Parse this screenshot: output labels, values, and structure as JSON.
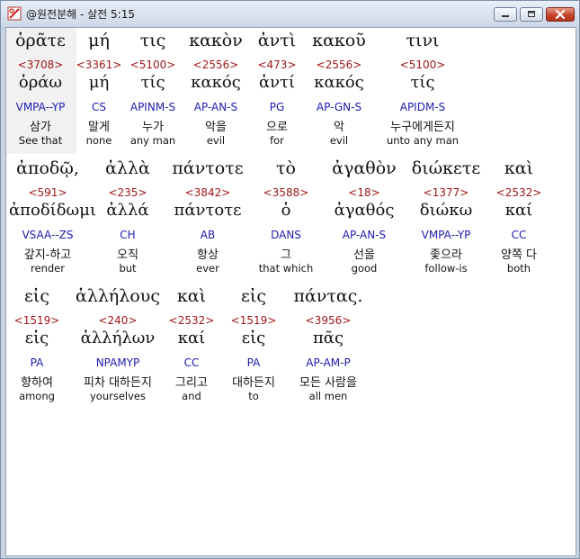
{
  "window": {
    "title": "@원전분해 - 살전 5:15"
  },
  "lines": [
    [
      {
        "greek": "ὁρᾶτε",
        "strongs": "<3708>",
        "lemma": "ὁράω",
        "parse": "VMPA--YP",
        "korean": "삼가",
        "english": "See that"
      },
      {
        "greek": "μή",
        "strongs": "<3361>",
        "lemma": "μή",
        "parse": "CS",
        "korean": "말게",
        "english": "none"
      },
      {
        "greek": "τις",
        "strongs": "<5100>",
        "lemma": "τίς",
        "parse": "APINM-S",
        "korean": "누가",
        "english": "any man"
      },
      {
        "greek": "κακὸν",
        "strongs": "<2556>",
        "lemma": "κακός",
        "parse": "AP-AN-S",
        "korean": "악을",
        "english": "evil"
      },
      {
        "greek": "ἀντὶ",
        "strongs": "<473>",
        "lemma": "ἀντί",
        "parse": "PG",
        "korean": "으로",
        "english": "for"
      },
      {
        "greek": "κακοῦ",
        "strongs": "<2556>",
        "lemma": "κακός",
        "parse": "AP-GN-S",
        "korean": "악",
        "english": "evil"
      },
      {
        "greek": "τινι",
        "strongs": "<5100>",
        "lemma": "τίς",
        "parse": "APIDM-S",
        "korean": "누구에게든지",
        "english": "unto any man"
      }
    ],
    [
      {
        "greek": "ἀποδῷ,",
        "strongs": "<591>",
        "lemma": "ἀποδίδωμι",
        "parse": "VSAA--ZS",
        "korean": "갚지-하고",
        "english": "render"
      },
      {
        "greek": "ἀλλὰ",
        "strongs": "<235>",
        "lemma": "ἀλλά",
        "parse": "CH",
        "korean": "오직",
        "english": "but"
      },
      {
        "greek": "πάντοτε",
        "strongs": "<3842>",
        "lemma": "πάντοτε",
        "parse": "AB",
        "korean": "항상",
        "english": "ever"
      },
      {
        "greek": "τὸ",
        "strongs": "<3588>",
        "lemma": "ὁ",
        "parse": "DANS",
        "korean": "그",
        "english": "that which"
      },
      {
        "greek": "ἀγαθὸν",
        "strongs": "<18>",
        "lemma": "ἀγαθός",
        "parse": "AP-AN-S",
        "korean": "선을",
        "english": "good"
      },
      {
        "greek": "διώκετε",
        "strongs": "<1377>",
        "lemma": "διώκω",
        "parse": "VMPA--YP",
        "korean": "좇으라",
        "english": "follow-is"
      },
      {
        "greek": "καὶ",
        "strongs": "<2532>",
        "lemma": "καί",
        "parse": "CC",
        "korean": "양쪽 다",
        "english": "both"
      }
    ],
    [
      {
        "greek": "εἰς",
        "strongs": "<1519>",
        "lemma": "εἰς",
        "parse": "PA",
        "korean": "향하여",
        "english": "among"
      },
      {
        "greek": "ἀλλήλους",
        "strongs": "<240>",
        "lemma": "ἀλλήλων",
        "parse": "NPAMYP",
        "korean": "피차 대하든지",
        "english": "yourselves"
      },
      {
        "greek": "καὶ",
        "strongs": "<2532>",
        "lemma": "καί",
        "parse": "CC",
        "korean": "그리고",
        "english": "and"
      },
      {
        "greek": "εἰς",
        "strongs": "<1519>",
        "lemma": "εἰς",
        "parse": "PA",
        "korean": "대하든지",
        "english": "to"
      },
      {
        "greek": "πάντας.",
        "strongs": "<3956>",
        "lemma": "πᾶς",
        "parse": "AP-AM-P",
        "korean": "모든 사람을",
        "english": "all men"
      }
    ]
  ]
}
